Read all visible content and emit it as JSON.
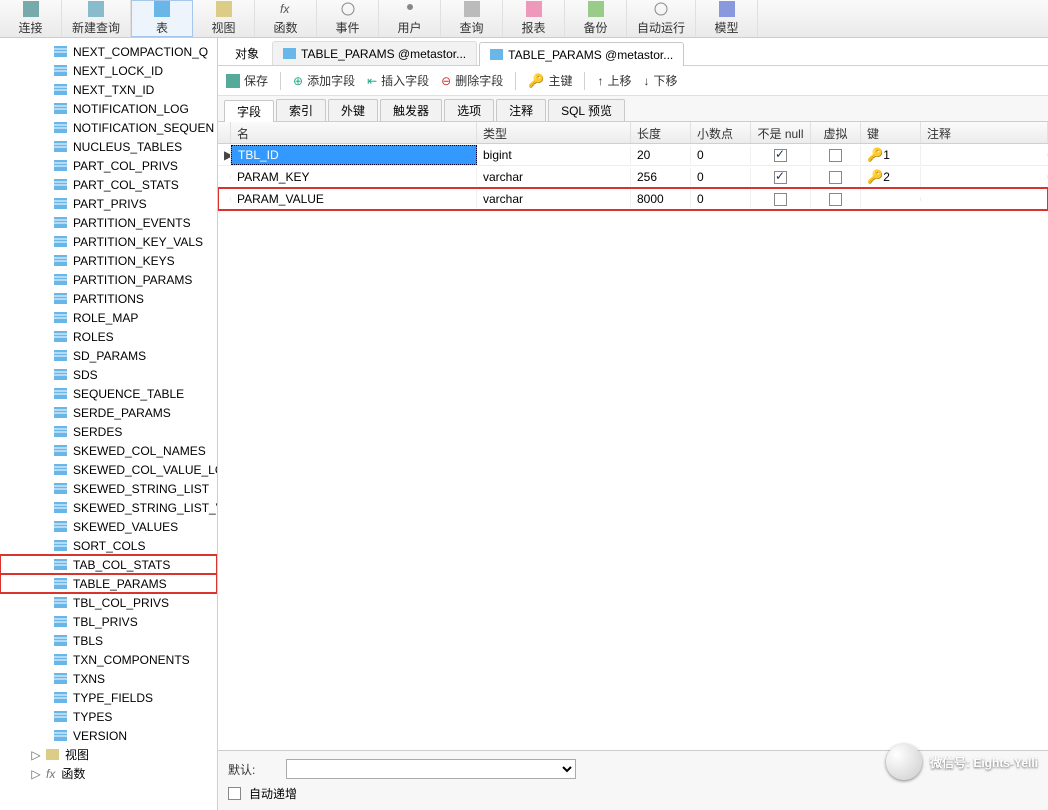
{
  "ribbon": {
    "connect": "连接",
    "new_query": "新建查询",
    "table": "表",
    "view": "视图",
    "function": "函数",
    "event": "事件",
    "user": "用户",
    "query": "查询",
    "report": "报表",
    "backup": "备份",
    "autorun": "自动运行",
    "model": "模型"
  },
  "sidebar": {
    "items": [
      "NEXT_COMPACTION_Q",
      "NEXT_LOCK_ID",
      "NEXT_TXN_ID",
      "NOTIFICATION_LOG",
      "NOTIFICATION_SEQUEN",
      "NUCLEUS_TABLES",
      "PART_COL_PRIVS",
      "PART_COL_STATS",
      "PART_PRIVS",
      "PARTITION_EVENTS",
      "PARTITION_KEY_VALS",
      "PARTITION_KEYS",
      "PARTITION_PARAMS",
      "PARTITIONS",
      "ROLE_MAP",
      "ROLES",
      "SD_PARAMS",
      "SDS",
      "SEQUENCE_TABLE",
      "SERDE_PARAMS",
      "SERDES",
      "SKEWED_COL_NAMES",
      "SKEWED_COL_VALUE_LO",
      "SKEWED_STRING_LIST",
      "SKEWED_STRING_LIST_V",
      "SKEWED_VALUES",
      "SORT_COLS",
      "TAB_COL_STATS",
      "TABLE_PARAMS",
      "TBL_COL_PRIVS",
      "TBL_PRIVS",
      "TBLS",
      "TXN_COMPONENTS",
      "TXNS",
      "TYPE_FIELDS",
      "TYPES",
      "VERSION"
    ],
    "highlighted": [
      "TAB_COL_STATS",
      "TABLE_PARAMS"
    ],
    "footer": {
      "view": "视图",
      "fx": "函数"
    }
  },
  "tabs": {
    "object": "对象",
    "tab1": "TABLE_PARAMS @metastor...",
    "tab2": "TABLE_PARAMS @metastor..."
  },
  "toolbar": {
    "save": "保存",
    "add": "添加字段",
    "insert": "插入字段",
    "delete": "删除字段",
    "pkey": "主键",
    "up": "上移",
    "down": "下移"
  },
  "subtabs": {
    "fields": "字段",
    "index": "索引",
    "fkey": "外键",
    "trigger": "触发器",
    "option": "选项",
    "comment": "注释",
    "sql": "SQL 预览"
  },
  "grid": {
    "headers": {
      "name": "名",
      "type": "类型",
      "len": "长度",
      "dec": "小数点",
      "nn": "不是 null",
      "virt": "虚拟",
      "key": "键",
      "note": "注释"
    },
    "rows": [
      {
        "name": "TBL_ID",
        "type": "bigint",
        "len": "20",
        "dec": "0",
        "nn": true,
        "virt": false,
        "key": "1",
        "selected": true
      },
      {
        "name": "PARAM_KEY",
        "type": "varchar",
        "len": "256",
        "dec": "0",
        "nn": true,
        "virt": false,
        "key": "2"
      },
      {
        "name": "PARAM_VALUE",
        "type": "varchar",
        "len": "8000",
        "dec": "0",
        "nn": false,
        "virt": false,
        "key": "",
        "redbox": true
      }
    ]
  },
  "bottom": {
    "default": "默认:",
    "autoinc": "自动递增"
  },
  "watermark": "微信号: Eights-Yelli"
}
